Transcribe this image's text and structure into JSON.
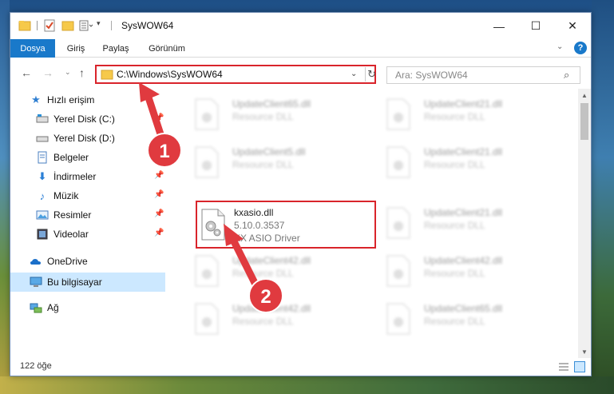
{
  "window": {
    "title": "SysWOW64",
    "controls": {
      "minimize": "—",
      "maximize": "☐",
      "close": "✕"
    }
  },
  "ribbon": {
    "tabs": [
      "Dosya",
      "Giriş",
      "Paylaş",
      "Görünüm"
    ],
    "collapse_chevron": "⌄",
    "help": "?"
  },
  "address": {
    "path": "C:\\Windows\\SysWOW64",
    "refresh_icon": "↻"
  },
  "search": {
    "placeholder": "Ara: SysWOW64",
    "icon": "⌕"
  },
  "sidebar": {
    "items": [
      {
        "label": "Hızlı erişim",
        "icon": "star-icon",
        "pinned": false
      },
      {
        "label": "Yerel Disk (C:)",
        "icon": "drive-icon",
        "pinned": true
      },
      {
        "label": "Yerel Disk (D:)",
        "icon": "drive-icon",
        "pinned": false
      },
      {
        "label": "Belgeler",
        "icon": "document-icon",
        "pinned": true
      },
      {
        "label": "İndirmeler",
        "icon": "download-icon",
        "pinned": true
      },
      {
        "label": "Müzik",
        "icon": "music-icon",
        "pinned": true
      },
      {
        "label": "Resimler",
        "icon": "pictures-icon",
        "pinned": true
      },
      {
        "label": "Videolar",
        "icon": "video-icon",
        "pinned": true
      },
      {
        "label": "OneDrive",
        "icon": "cloud-icon",
        "pinned": false
      },
      {
        "label": "Bu bilgisayar",
        "icon": "computer-icon",
        "pinned": false,
        "selected": true
      },
      {
        "label": "Ağ",
        "icon": "network-icon",
        "pinned": false
      }
    ]
  },
  "files": [
    {
      "name": "UpdateClient65.dll",
      "desc": "Resource DLL"
    },
    {
      "name": "UpdateClient21.dll",
      "desc": "Resource DLL"
    },
    {
      "name": "UpdateClient5.dll",
      "desc": "Resource DLL"
    },
    {
      "name": "UpdateClient21.dll",
      "desc": "Resource DLL"
    },
    {
      "name": "kxasio.dll",
      "version": "5.10.0.3537",
      "desc": "KX ASIO Driver",
      "highlighted": true
    },
    {
      "name": "UpdateClient21.dll",
      "desc": "Resource DLL"
    },
    {
      "name": "UpdateClient42.dll",
      "desc": "Resource DLL"
    },
    {
      "name": "UpdateClient42.dll",
      "desc": "Resource DLL"
    },
    {
      "name": "UpdateClient42.dll",
      "desc": "Resource DLL"
    },
    {
      "name": "UpdateClient65.dll",
      "desc": "Resource DLL"
    }
  ],
  "status": {
    "count": "122 öğe"
  },
  "annotations": {
    "step1": "1",
    "step2": "2",
    "color": "#e03a3f"
  }
}
